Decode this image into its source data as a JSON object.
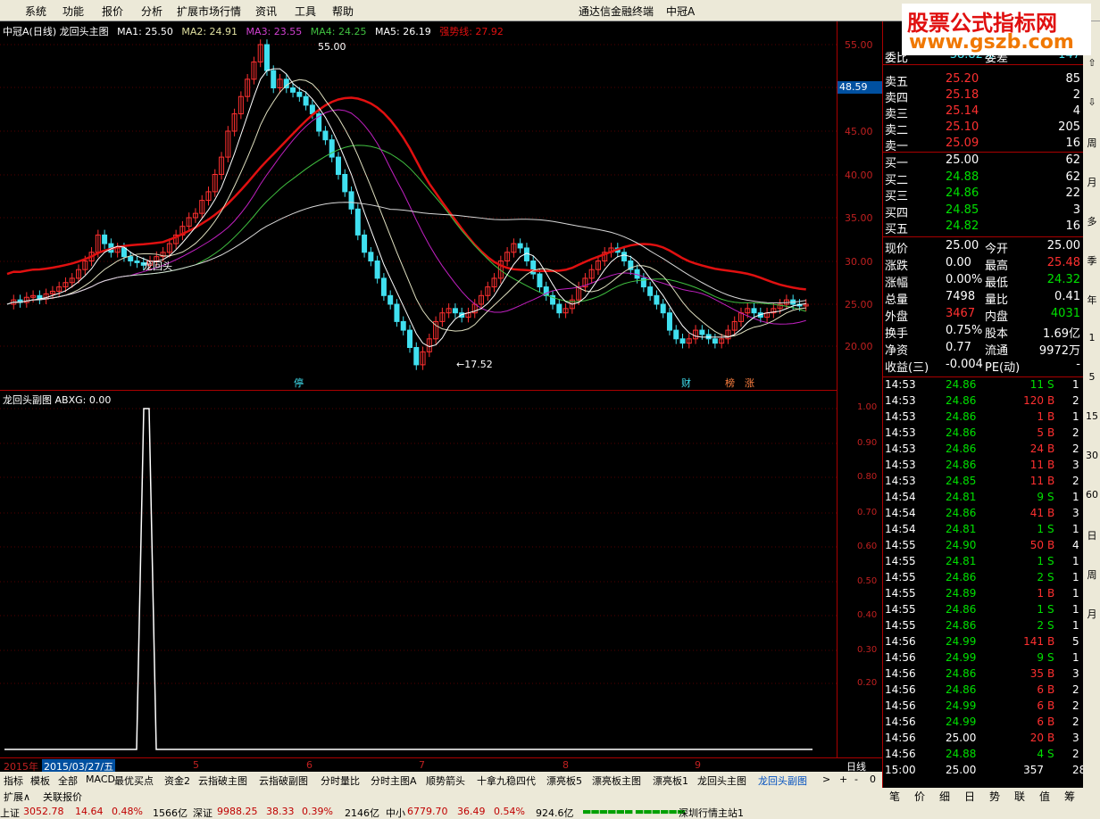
{
  "menu": {
    "items": [
      "系统",
      "功能",
      "报价",
      "分析",
      "扩展市场行情",
      "资讯",
      "工具",
      "帮助"
    ],
    "center_title": "通达信金融终端",
    "stock": "中冠A"
  },
  "logo": {
    "line1": "股票公式指标网",
    "line2": "www.gszb.com"
  },
  "main_header": {
    "title": "中冠A(日线) 龙回头主图",
    "ma1": "MA1: 25.50",
    "ma2": "MA2: 24.91",
    "ma3": "MA3: 23.55",
    "ma4": "MA4: 24.25",
    "ma5": "MA5: 26.19",
    "pressure": "强势线: 27.92"
  },
  "main_annotations": {
    "high": "55.00",
    "low": "←17.52",
    "signal": "龙回头",
    "marker1": "停",
    "marker2": "财",
    "marker3": "榜",
    "marker4": "涨"
  },
  "sub_header": {
    "title": "龙回头副图 ABXG: 0.00"
  },
  "y_main": [
    "55.00",
    "50.00",
    "45.00",
    "40.00",
    "35.00",
    "30.00",
    "25.00",
    "20.00"
  ],
  "y_sub": [
    "1.00",
    "0.90",
    "0.80",
    "0.70",
    "0.60",
    "0.50",
    "0.40",
    "0.30",
    "0.20"
  ],
  "current_price_box": "48.59",
  "x_axis": {
    "year": "2015年",
    "date": "2015/03/27/五",
    "months": [
      "5",
      "6",
      "7",
      "8",
      "9"
    ],
    "period": "日线"
  },
  "tabs": [
    "指标",
    "模板",
    "全部",
    "MACD",
    "最优买点",
    "资金2",
    "云指破主图",
    "云指破副图",
    "分时量比",
    "分时主图A",
    "顺势箭头",
    "十拿九稳四代",
    "漂亮板5",
    "漂亮板主图",
    "漂亮板1",
    "龙回头主图",
    "龙回头副图"
  ],
  "tab_active": "龙回头副图",
  "tab_nav": [
    ">",
    "+",
    "-",
    "0"
  ],
  "ext_row": [
    "扩展∧",
    "关联报价"
  ],
  "panel": {
    "top": {
      "label": "委比",
      "value": "-38.82%",
      "label2": "委差",
      "value2": "-147"
    },
    "asks": [
      {
        "label": "卖五",
        "price": "25.20",
        "vol": "85"
      },
      {
        "label": "卖四",
        "price": "25.18",
        "vol": "2"
      },
      {
        "label": "卖三",
        "price": "25.14",
        "vol": "4"
      },
      {
        "label": "卖二",
        "price": "25.10",
        "vol": "205"
      },
      {
        "label": "卖一",
        "price": "25.09",
        "vol": "16"
      }
    ],
    "bids": [
      {
        "label": "买一",
        "price": "25.00",
        "vol": "62"
      },
      {
        "label": "买二",
        "price": "24.88",
        "vol": "62"
      },
      {
        "label": "买三",
        "price": "24.86",
        "vol": "22"
      },
      {
        "label": "买四",
        "price": "24.85",
        "vol": "3"
      },
      {
        "label": "买五",
        "price": "24.82",
        "vol": "16"
      }
    ],
    "stats": [
      {
        "k1": "现价",
        "v1": "25.00",
        "k2": "今开",
        "v2": "25.00"
      },
      {
        "k1": "涨跌",
        "v1": "0.00",
        "k2": "最高",
        "v2": "25.48"
      },
      {
        "k1": "涨幅",
        "v1": "0.00%",
        "k2": "最低",
        "v2": "24.32"
      },
      {
        "k1": "总量",
        "v1": "7498",
        "k2": "量比",
        "v2": "0.41"
      },
      {
        "k1": "外盘",
        "v1": "3467",
        "k2": "内盘",
        "v2": "4031"
      },
      {
        "k1": "换手",
        "v1": "0.75%",
        "k2": "股本",
        "v2": "1.69亿"
      },
      {
        "k1": "净资",
        "v1": "0.77",
        "k2": "流通",
        "v2": "9972万"
      },
      {
        "k1": "收益(三)",
        "v1": "-0.004",
        "k2": "PE(动)",
        "v2": "-"
      }
    ],
    "ticks": [
      {
        "t": "14:53",
        "p": "24.86",
        "v": "11",
        "s": "S",
        "n": "1"
      },
      {
        "t": "14:53",
        "p": "24.86",
        "v": "120",
        "s": "B",
        "n": "2"
      },
      {
        "t": "14:53",
        "p": "24.86",
        "v": "1",
        "s": "B",
        "n": "1"
      },
      {
        "t": "14:53",
        "p": "24.86",
        "v": "5",
        "s": "B",
        "n": "2"
      },
      {
        "t": "14:53",
        "p": "24.86",
        "v": "24",
        "s": "B",
        "n": "2"
      },
      {
        "t": "14:53",
        "p": "24.86",
        "v": "11",
        "s": "B",
        "n": "3"
      },
      {
        "t": "14:53",
        "p": "24.85",
        "v": "11",
        "s": "B",
        "n": "2"
      },
      {
        "t": "14:54",
        "p": "24.81",
        "v": "9",
        "s": "S",
        "n": "1"
      },
      {
        "t": "14:54",
        "p": "24.86",
        "v": "41",
        "s": "B",
        "n": "3"
      },
      {
        "t": "14:54",
        "p": "24.81",
        "v": "1",
        "s": "S",
        "n": "1"
      },
      {
        "t": "14:55",
        "p": "24.90",
        "v": "50",
        "s": "B",
        "n": "4"
      },
      {
        "t": "14:55",
        "p": "24.81",
        "v": "1",
        "s": "S",
        "n": "1"
      },
      {
        "t": "14:55",
        "p": "24.86",
        "v": "2",
        "s": "S",
        "n": "1"
      },
      {
        "t": "14:55",
        "p": "24.89",
        "v": "1",
        "s": "B",
        "n": "1"
      },
      {
        "t": "14:55",
        "p": "24.86",
        "v": "1",
        "s": "S",
        "n": "1"
      },
      {
        "t": "14:55",
        "p": "24.86",
        "v": "2",
        "s": "S",
        "n": "1"
      },
      {
        "t": "14:56",
        "p": "24.99",
        "v": "141",
        "s": "B",
        "n": "5"
      },
      {
        "t": "14:56",
        "p": "24.99",
        "v": "9",
        "s": "S",
        "n": "1"
      },
      {
        "t": "14:56",
        "p": "24.86",
        "v": "35",
        "s": "B",
        "n": "3"
      },
      {
        "t": "14:56",
        "p": "24.86",
        "v": "6",
        "s": "B",
        "n": "2"
      },
      {
        "t": "14:56",
        "p": "24.99",
        "v": "6",
        "s": "B",
        "n": "2"
      },
      {
        "t": "14:56",
        "p": "24.99",
        "v": "6",
        "s": "B",
        "n": "2"
      },
      {
        "t": "14:56",
        "p": "25.00",
        "v": "20",
        "s": "B",
        "n": "3"
      },
      {
        "t": "14:56",
        "p": "24.88",
        "v": "4",
        "s": "S",
        "n": "2"
      },
      {
        "t": "15:00",
        "p": "25.00",
        "v": "357",
        "s": "",
        "n": "28"
      }
    ]
  },
  "panel_tabs": [
    "笔",
    "价",
    "细",
    "日",
    "势",
    "联",
    "值",
    "筹"
  ],
  "right_tools": [
    "⇧",
    "⇩",
    "周",
    "月",
    "多",
    "季",
    "年",
    "1",
    "5",
    "15",
    "30",
    "60",
    "日",
    "周",
    "月"
  ],
  "status": {
    "sh": "上证",
    "sh_val": "3052.78",
    "sh_chg": "14.64",
    "sh_pct": "0.48%",
    "sh_amt": "1566亿",
    "sz": "深证",
    "sz_val": "9988.25",
    "sz_chg": "38.33",
    "sz_pct": "0.39%",
    "sz_amt": "2146亿",
    "zx": "中小",
    "zx_val": "6779.70",
    "zx_chg": "36.49",
    "zx_pct": "0.54%",
    "zx_amt": "924.6亿",
    "server": "深圳行情主站1"
  },
  "colors": {
    "up": "#FF3030",
    "down": "#40E0F0",
    "ma1": "#FFFFFF",
    "ma2": "#E0E0A0",
    "ma3": "#C020C0",
    "ma4": "#40C040",
    "ma5": "#FFFFFF",
    "pressure": "#E01010"
  }
}
